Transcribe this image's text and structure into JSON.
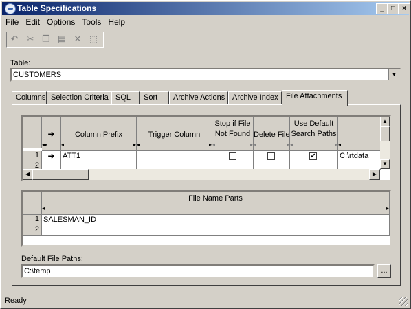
{
  "window": {
    "title": "Table Specifications"
  },
  "menu": [
    "File",
    "Edit",
    "Options",
    "Tools",
    "Help"
  ],
  "toolbar": {
    "icons": [
      "undo-icon",
      "cut-icon",
      "copy-icon",
      "paste-icon",
      "delete-icon",
      "select-icon"
    ]
  },
  "table_field": {
    "label": "Table:",
    "value": "CUSTOMERS"
  },
  "tabs": [
    "Columns",
    "Selection Criteria",
    "SQL",
    "Sort",
    "Archive Actions",
    "Archive Index",
    "File Attachments"
  ],
  "active_tab": "File Attachments",
  "attachments_grid": {
    "arrow_header": "➔",
    "headers": {
      "column_prefix": "Column Prefix",
      "trigger_column": "Trigger Column",
      "stop_if_file_1": "Stop if File",
      "stop_if_file_2": "Not Found",
      "delete_file": "Delete File",
      "use_default_1": "Use Default",
      "use_default_2": "Search Paths"
    },
    "rows": [
      {
        "num": "1",
        "pointer": "➔",
        "column_prefix": "ATT1",
        "trigger_column": "",
        "stop_if_not_found": false,
        "delete_file": false,
        "use_default_search_paths": true,
        "path": "C:\\rtdata"
      },
      {
        "num": "2",
        "pointer": "",
        "column_prefix": "",
        "trigger_column": "",
        "path": ""
      }
    ]
  },
  "file_name_parts_grid": {
    "header": "File Name Parts",
    "rows": [
      {
        "num": "1",
        "value": "SALESMAN_ID"
      },
      {
        "num": "2",
        "value": ""
      }
    ]
  },
  "default_file_paths": {
    "label": "Default File Paths:",
    "value": "C:\\temp",
    "browse_label": "..."
  },
  "status": "Ready"
}
